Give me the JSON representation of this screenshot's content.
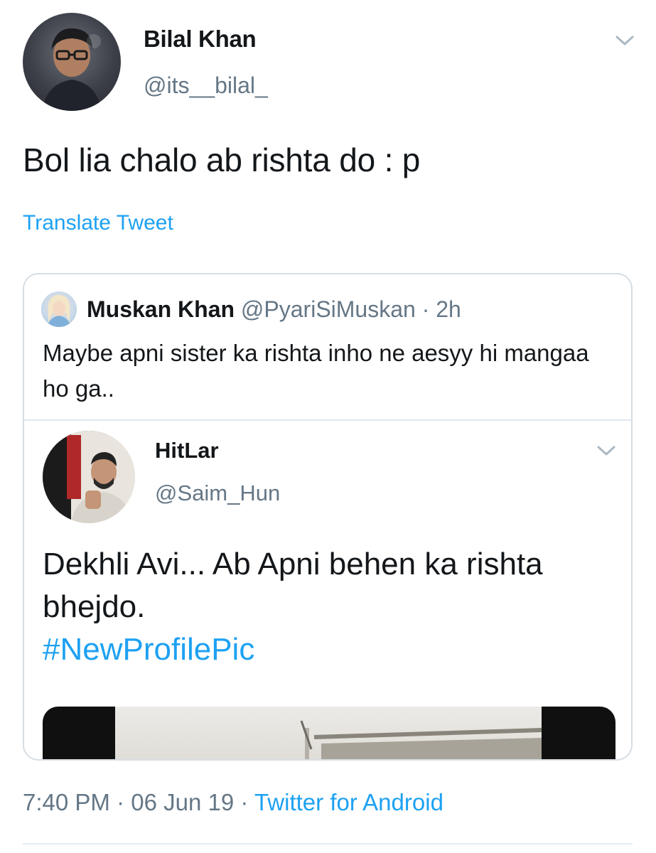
{
  "tweet": {
    "author_name": "Bilal Khan",
    "author_handle": "@its__bilal_",
    "text": "Bol lia chalo ab rishta do : p",
    "translate_label": "Translate Tweet",
    "menu_icon": "chevron-down-icon"
  },
  "quoted": {
    "author_name": "Muskan Khan",
    "author_handle": "@PyariSiMuskan",
    "separator": "·",
    "time": "2h",
    "text": "Maybe apni sister ka rishta inho ne aesyy hi mangaa ho ga..",
    "embedded": {
      "author_name": "HitLar",
      "author_handle": "@Saim_Hun",
      "text": "Dekhli Avi... Ab Apni behen ka rishta bhejdo.",
      "hashtag": "#NewProfilePic",
      "menu_icon": "chevron-down-icon"
    }
  },
  "footer": {
    "time": "7:40 PM",
    "separator_1": "·",
    "date": "06 Jun 19",
    "separator_2": "·",
    "source": "Twitter for Android"
  },
  "colors": {
    "text_primary": "#14171a",
    "text_secondary": "#657786",
    "link": "#1da1f2",
    "border": "#d6dde3"
  }
}
